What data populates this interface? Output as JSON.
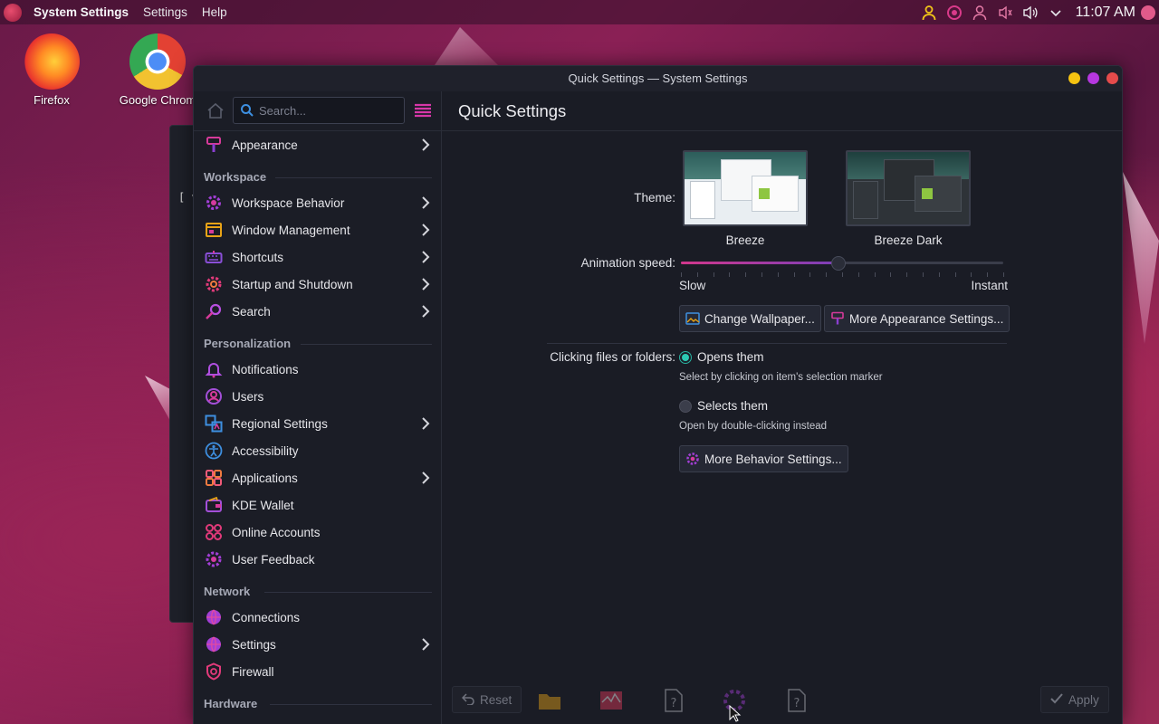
{
  "top_panel": {
    "app_name": "System Settings",
    "menus": [
      "Settings",
      "Help"
    ],
    "clock": "11:07 AM"
  },
  "desktop": {
    "icons": [
      {
        "label": "Firefox"
      },
      {
        "label": "Google Chrom"
      }
    ],
    "bg_window_text": "[ vi"
  },
  "window": {
    "title": "Quick Settings — System Settings"
  },
  "sidebar": {
    "search_placeholder": "Search...",
    "appearance": "Appearance",
    "sections": {
      "workspace": "Workspace",
      "personalization": "Personalization",
      "network": "Network",
      "hardware": "Hardware"
    },
    "workspace_items": [
      {
        "label": "Workspace Behavior"
      },
      {
        "label": "Window Management"
      },
      {
        "label": "Shortcuts"
      },
      {
        "label": "Startup and Shutdown"
      },
      {
        "label": "Search"
      }
    ],
    "personalization_items": [
      {
        "label": "Notifications"
      },
      {
        "label": "Users"
      },
      {
        "label": "Regional Settings"
      },
      {
        "label": "Accessibility"
      },
      {
        "label": "Applications"
      },
      {
        "label": "KDE Wallet"
      },
      {
        "label": "Online Accounts"
      },
      {
        "label": "User Feedback"
      }
    ],
    "network_items": [
      {
        "label": "Connections"
      },
      {
        "label": "Settings"
      },
      {
        "label": "Firewall"
      }
    ]
  },
  "content": {
    "title": "Quick Settings",
    "theme_label": "Theme:",
    "themes": [
      {
        "name": "Breeze"
      },
      {
        "name": "Breeze Dark"
      }
    ],
    "animation_label": "Animation speed:",
    "animation_value": 0.49,
    "slow_label": "Slow",
    "instant_label": "Instant",
    "change_wallpaper": "Change Wallpaper...",
    "more_appearance": "More Appearance Settings...",
    "clicking_label": "Clicking files or folders:",
    "opens_them": "Opens them",
    "opens_hint": "Select by clicking on item's selection marker",
    "selects_them": "Selects them",
    "selects_hint": "Open by double-clicking instead",
    "more_behavior": "More Behavior Settings..."
  },
  "footer": {
    "reset": "Reset",
    "apply": "Apply"
  },
  "colors": {
    "accent_pink": "#d2378c",
    "accent_purple": "#7a3fb8",
    "radio_on": "#2cc9b3",
    "window_bg": "#1a1c25"
  }
}
